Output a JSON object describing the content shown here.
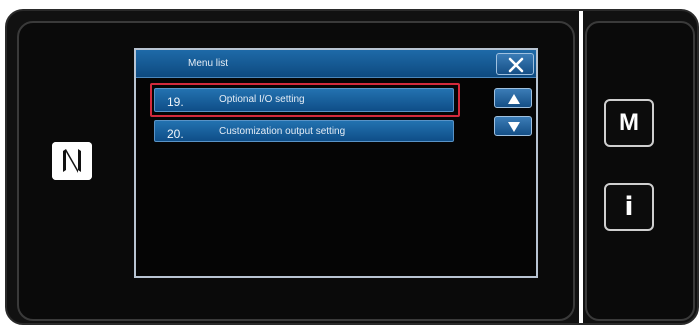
{
  "screen": {
    "title": "Menu list",
    "close_icon": "close-icon"
  },
  "menu": {
    "items": [
      {
        "number": "19.",
        "label": "Optional I/O setting",
        "selected": true
      },
      {
        "number": "20.",
        "label": "Customization output setting",
        "selected": false
      }
    ]
  },
  "scroll": {
    "up_icon": "arrow-up-icon",
    "down_icon": "arrow-down-icon"
  },
  "side_buttons": {
    "mode": "M",
    "info": "i"
  },
  "logo": {
    "name": "nfc-logo-icon"
  },
  "colors": {
    "title_bar": "#1e6aa8",
    "item_button": "#1b66a3",
    "highlight": "#d32a3c"
  }
}
